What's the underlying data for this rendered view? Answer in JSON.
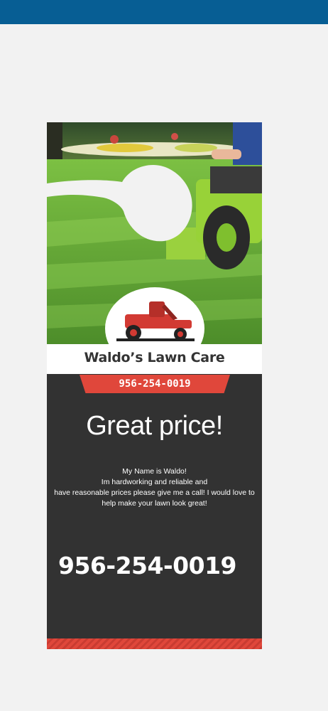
{
  "app": {
    "header_color": "#075e94"
  },
  "door_hanger": {
    "business_name": "Waldo’s Lawn Care",
    "phone_tab": "956-254-0019",
    "headline": "Great price!",
    "body_lines": [
      "My Name is Waldo!",
      "Im hardworking and reliable and",
      "have reasonable prices please give me a call! I would love to",
      "help make your lawn look great!"
    ],
    "phone_large": "956-254-0019",
    "colors": {
      "accent": "#e0473b",
      "panel": "#323232",
      "grass": "#5c9d33"
    }
  }
}
